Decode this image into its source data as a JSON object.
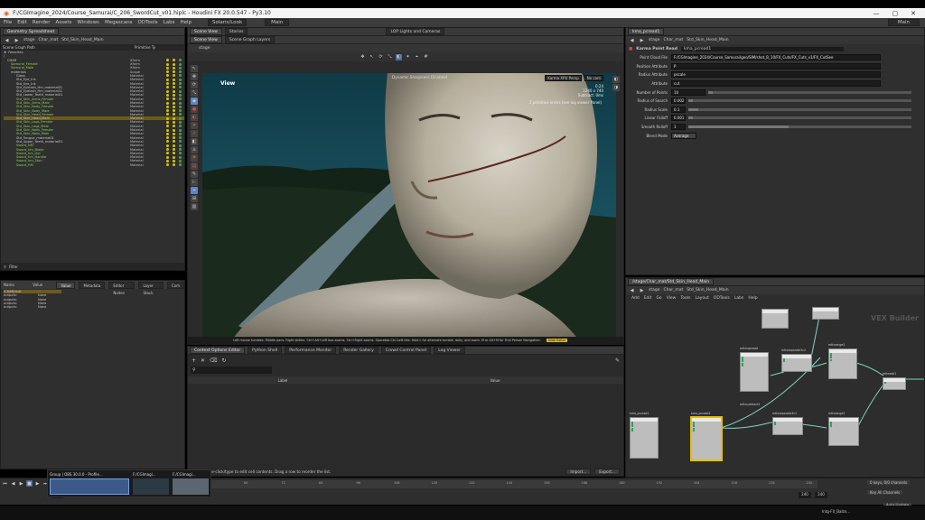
{
  "window": {
    "title": "F:/CGImagine_2024/Course_Samurai/C_206_SwordCut_v01.hiplc - Houdini FX 20.0.547 - Py3.10",
    "minimize": "—",
    "maximize": "▢",
    "close": "✕"
  },
  "menu": {
    "items": [
      "File",
      "Edit",
      "Render",
      "Assets",
      "Windows",
      "Megascans",
      "ODTools",
      "Labs",
      "Help"
    ],
    "solaris": "Solaris/Look",
    "desktop": "Main",
    "right_desk": "Main"
  },
  "scene_graph": {
    "tab": "Geometry Spreadsheet",
    "path": "stage",
    "path2": "Char_mat",
    "path3": "Std_Skin_Head_Main",
    "header_name": "Scene Graph Path",
    "header_prim": "Primitive Ty",
    "favorites": "Favorites",
    "rows": [
      {
        "name": "/",
        "type": "",
        "cls": ""
      },
      {
        "name": "CHAR",
        "type": "Xform",
        "cls": ""
      },
      {
        "name": "Samurai_Female",
        "type": "Xform",
        "cls": "green"
      },
      {
        "name": "Samurai_Male",
        "type": "Xform",
        "cls": "green"
      },
      {
        "name": "materials",
        "type": "Scope",
        "cls": ""
      },
      {
        "name": "Glass",
        "type": "Material",
        "cls": ""
      },
      {
        "name": "Std_Eye_Iris",
        "type": "Material",
        "cls": ""
      },
      {
        "name": "Std_Eye_Iris",
        "type": "Material",
        "cls": ""
      },
      {
        "name": "Std_Eyelash_Hm_material01",
        "type": "Material",
        "cls": ""
      },
      {
        "name": "Std_Eyelash_Hm_material01",
        "type": "Material",
        "cls": ""
      },
      {
        "name": "Std_Lower_Teeth_material01",
        "type": "Material",
        "cls": ""
      },
      {
        "name": "Std_Skin_Arms_Female",
        "type": "Material",
        "cls": "green"
      },
      {
        "name": "Std_Skin_Arms_Male",
        "type": "Material",
        "cls": "green"
      },
      {
        "name": "Std_Skin_Body_Female",
        "type": "Material",
        "cls": "green"
      },
      {
        "name": "Std_Skin_Body_Male",
        "type": "Material",
        "cls": "green"
      },
      {
        "name": "Std_Skin_Head_Female",
        "type": "Material",
        "cls": "green"
      },
      {
        "name": "Std_Skin_Head_Main",
        "type": "Material",
        "cls": "sel"
      },
      {
        "name": "Std_Skin_Legs_Female",
        "type": "Material",
        "cls": "green"
      },
      {
        "name": "Std_Skin_Legs_Male",
        "type": "Material",
        "cls": "green"
      },
      {
        "name": "Std_Skin_Nails_Female",
        "type": "Material",
        "cls": "green"
      },
      {
        "name": "Std_Skin_Nails_Male",
        "type": "Material",
        "cls": "green"
      },
      {
        "name": "Std_Tongue_material01",
        "type": "Material",
        "cls": ""
      },
      {
        "name": "Std_Upper_Teeth_material01",
        "type": "Material",
        "cls": ""
      },
      {
        "name": "Sword_HM",
        "type": "Material",
        "cls": "green"
      },
      {
        "name": "Sword_hm_Blade",
        "type": "Material",
        "cls": "green"
      },
      {
        "name": "Sword_hm_Gol",
        "type": "Material",
        "cls": "green"
      },
      {
        "name": "Sword_hm_Handle",
        "type": "Material",
        "cls": "green"
      },
      {
        "name": "Sword_hm_Ston",
        "type": "Material",
        "cls": "green"
      },
      {
        "name": "Sword_HM",
        "type": "Material",
        "cls": "green"
      }
    ],
    "filter_label": "Filter"
  },
  "attr_panel": {
    "tabs": [
      "Value",
      "Metadata",
      "Editor Nodes",
      "Layer Stack",
      "Com"
    ],
    "header_name": "Name",
    "header_value": "Value",
    "rows": [
      {
        "name": "/CHAR/mat",
        "value": ""
      },
      {
        "name": "outputs:",
        "value": "None"
      },
      {
        "name": "outputs:",
        "value": "None"
      },
      {
        "name": "outputs:",
        "value": "None"
      },
      {
        "name": "outputs:",
        "value": "None"
      }
    ]
  },
  "viewport": {
    "tabs": [
      "Scene View",
      "Stories"
    ],
    "tabs2": [
      "Scene View",
      "Scene Graph Layers"
    ],
    "lop_tab": "LOP Lights and Cameras",
    "path": "stage",
    "label": "View",
    "renderer": "Karma XPU Persp",
    "camera": "No cam",
    "stats": "0:24\n1240 x 740\nSubtract: 0ms",
    "overlay_text": "Dynamic Sharpness Disabled",
    "msg": "2 primitive errors (see log viewer Panel)",
    "hint": "Left mouse tumbles. Middle pans. Right dollies. Ctrl+Alt+Left box zooms. Ctrl+Right zooms. Spacebar-Ctrl-Left tilts. Hold L for alternate tumble, dolly, and zoom. M or Alt+M for First Person Navigation.",
    "hint_mode": "Slide Editor"
  },
  "bottom_left": {
    "tabs": [
      "Context Options Editor",
      "Python Shell",
      "Performance Monitor",
      "Render Gallery",
      "Crowd Control Panel",
      "Log Viewer"
    ],
    "col_label": "Label",
    "col_value": "Value",
    "status": "Double-click/type to edit cell contents. Drag a row to reorder the list.",
    "import_btn": "Import...",
    "export_btn": "Export..."
  },
  "params": {
    "tab": "kma_pcread1",
    "path": "stage",
    "path2": "Char_mat",
    "path3": "Std_Skin_Head_Main",
    "node_title": "Karma Point Read",
    "node_name": "kma_pcread1",
    "fields": [
      {
        "label": "Point Cloud File",
        "value": "F:/CGImagine_2024/Course_Samurai/geo/SIM/shot_B_10/FX_Cuts/FX_Cuts_v1/FX_CutSee"
      },
      {
        "label": "Position Attribute",
        "value": "P"
      },
      {
        "label": "Radius Attribute",
        "value": "pscale"
      },
      {
        "label": "Attribute",
        "value": "cut"
      },
      {
        "label": "Number of Points",
        "value": "10"
      },
      {
        "label": "Radius of Search",
        "value": "0.002"
      },
      {
        "label": "Radius Scale",
        "value": "0.1"
      },
      {
        "label": "Linear Falloff",
        "value": "0.001"
      },
      {
        "label": "Smooth Rolloff",
        "value": "1"
      }
    ],
    "sliders": [
      0.0,
      0.0,
      0.0,
      0.0,
      0.02,
      0.02,
      0.1,
      0.001,
      1.0
    ],
    "blend_label": "Blend Mode",
    "blend_value": "Average"
  },
  "network": {
    "tab": "/stage/Char_mat/Std_Skin_Head_Main",
    "path": "stage",
    "path2": "Char_mat",
    "path3": "Std_Skin_Head_Main",
    "menu": [
      "Add",
      "Edit",
      "Go",
      "View",
      "Tools",
      "Layout",
      "ODTools",
      "Labs",
      "Help"
    ],
    "watermark": "VEX Builder",
    "nodes": [
      {
        "label": "kma_pcread1"
      },
      {
        "label": "kma_pcread2"
      },
      {
        "label": "mtlxsqaradd"
      },
      {
        "label": "mtlxseparate3c2"
      },
      {
        "label": "mtlxsubtract1"
      },
      {
        "label": "mtlxrange1"
      },
      {
        "label": "mtlxseparate3c1"
      },
      {
        "label": "mtlxrange2"
      },
      {
        "label": "mtlxadd1"
      }
    ]
  },
  "timeline": {
    "frame_start": "1",
    "frame_current": "1",
    "frame_end": "240",
    "frame_end2": "240",
    "marks": [
      "12",
      "24",
      "36",
      "48",
      "60",
      "72",
      "84",
      "96",
      "108",
      "120",
      "132",
      "144",
      "156",
      "168",
      "180",
      "192",
      "204",
      "216",
      "228",
      "240"
    ],
    "keys_label": "0 keys, 0/0 channels",
    "key_all": "Key All Channels",
    "auto_update": "Auto Update"
  },
  "taskbar": {
    "obs": "Group | OBS 30.0.0 - Profile...",
    "f1": "F:/CGImagi...",
    "f2": "F:/CGImagi...",
    "tray": "Intg-FX_Balzn..."
  }
}
